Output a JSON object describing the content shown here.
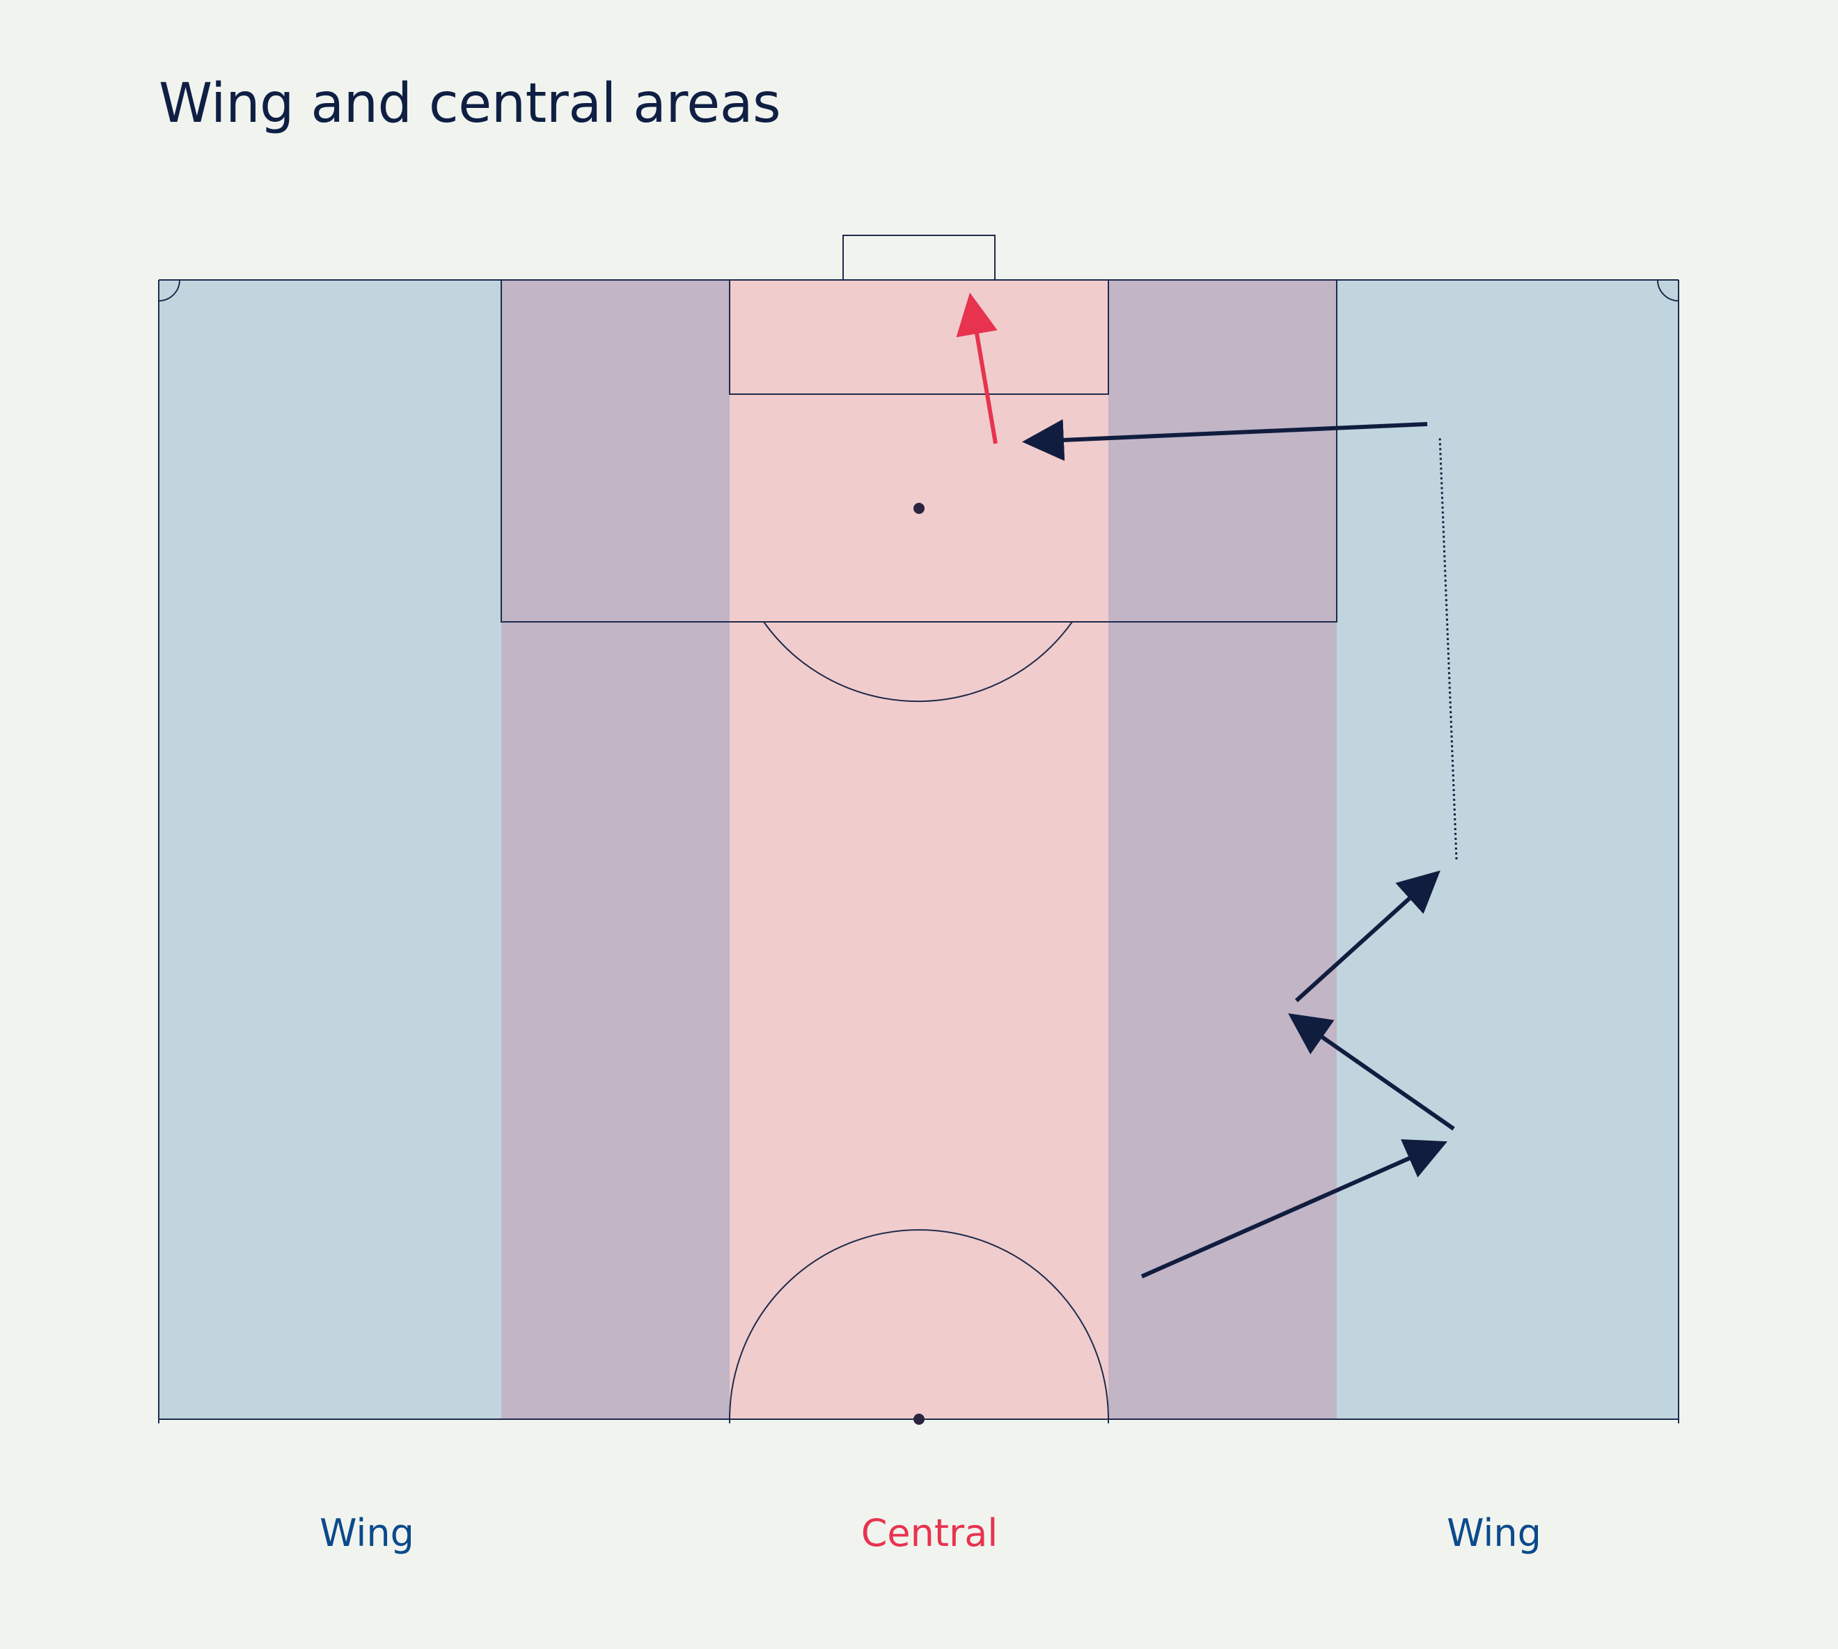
{
  "title": "Wing and central areas",
  "zones": [
    {
      "key": "wing-left",
      "label": "Wing",
      "label_color": "#0b4a8c",
      "fill": "#c1d5df"
    },
    {
      "key": "half-space-left",
      "label": "",
      "fill": "#c1b5c6"
    },
    {
      "key": "central",
      "label": "Central",
      "label_color": "#e8334f",
      "fill": "#f0cccd"
    },
    {
      "key": "half-space-right",
      "label": "",
      "fill": "#c1b5c6"
    },
    {
      "key": "wing-right",
      "label": "Wing",
      "label_color": "#0b4a8c",
      "fill": "#c1d5df"
    }
  ],
  "colors": {
    "background": "#f1f4ee",
    "lines": "#1e2a4a",
    "arrow_dark": "#111d3f",
    "arrow_accent": "#e8334f"
  },
  "moves": [
    {
      "type": "pass",
      "color": "dark",
      "order": 1
    },
    {
      "type": "pass",
      "color": "dark",
      "order": 2
    },
    {
      "type": "pass",
      "color": "dark",
      "order": 3
    },
    {
      "type": "carry",
      "color": "dark",
      "order": 4,
      "style": "dotted"
    },
    {
      "type": "pass",
      "color": "dark",
      "order": 5
    },
    {
      "type": "shot",
      "color": "accent",
      "order": 6
    }
  ]
}
